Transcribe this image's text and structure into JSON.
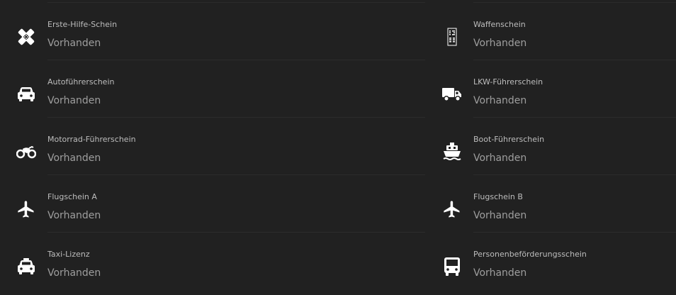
{
  "licenses": {
    "left": [
      {
        "label": "Erste-Hilfe-Schein",
        "value": "Vorhanden",
        "icon": "first-aid-icon"
      },
      {
        "label": "Autoführerschein",
        "value": "Vorhanden",
        "icon": "car-icon"
      },
      {
        "label": "Motorrad-Führerschein",
        "value": "Vorhanden",
        "icon": "motorcycle-icon"
      },
      {
        "label": "Flugschein A",
        "value": "Vorhanden",
        "icon": "airplane-icon"
      },
      {
        "label": "Taxi-Lizenz",
        "value": "Vorhanden",
        "icon": "taxi-icon"
      }
    ],
    "right": [
      {
        "label": "Waffenschein",
        "value": "Vorhanden",
        "icon": "weapon-license-icon"
      },
      {
        "label": "LKW-Führerschein",
        "value": "Vorhanden",
        "icon": "truck-icon"
      },
      {
        "label": "Boot-Führerschein",
        "value": "Vorhanden",
        "icon": "boat-icon"
      },
      {
        "label": "Flugschein B",
        "value": "Vorhanden",
        "icon": "airplane-icon"
      },
      {
        "label": "Personenbeförderungsschein",
        "value": "Vorhanden",
        "icon": "bus-icon"
      }
    ]
  },
  "colors": {
    "background": "#212121",
    "label": "#bdbdbd",
    "value": "#9e9e9e",
    "icon": "#ffffff",
    "divider": "#2c2c2c"
  }
}
